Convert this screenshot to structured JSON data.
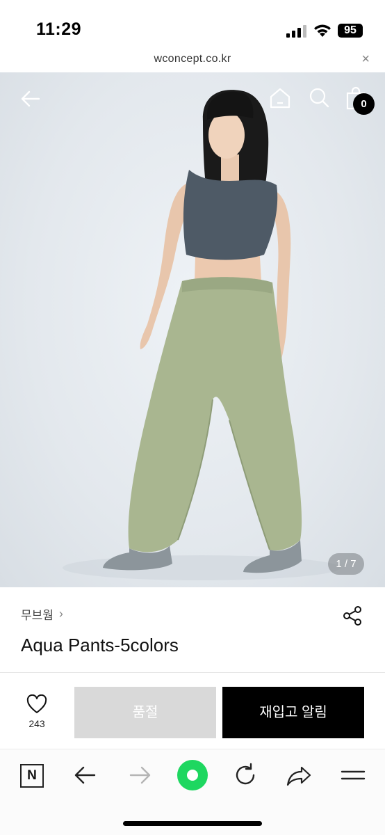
{
  "status": {
    "time": "11:29",
    "battery": "95"
  },
  "browser": {
    "url": "wconcept.co.kr",
    "close_symbol": "×"
  },
  "hero": {
    "cart_count": "0",
    "pager": "1 / 7"
  },
  "product": {
    "brand": "무브웜",
    "title": "Aqua Pants-5colors"
  },
  "actions": {
    "like_count": "243",
    "soldout_label": "품절",
    "restock_label": "재입고 알림"
  },
  "toolbar": {
    "n_label": "N",
    "icons": [
      "naver-n-icon",
      "back-arrow-icon",
      "forward-arrow-icon",
      "green-dot-icon",
      "refresh-icon",
      "share-arrow-icon",
      "menu-icon"
    ]
  },
  "colors": {
    "accent_green": "#1ed760",
    "black": "#000000",
    "soldout_gray": "#d9d9d9"
  }
}
